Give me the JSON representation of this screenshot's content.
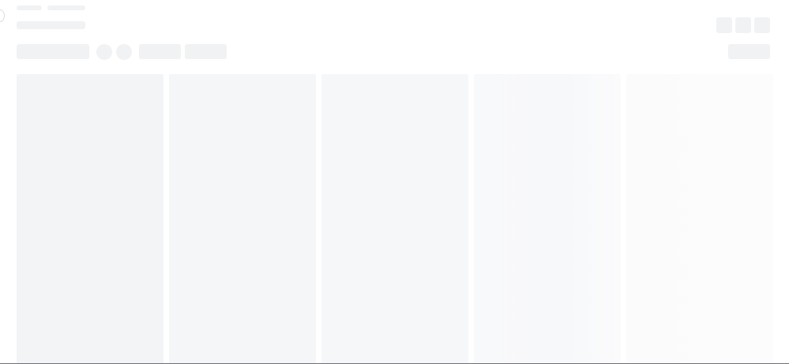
{
  "app": {
    "state": "loading-skeleton"
  },
  "header": {
    "breadcrumb": [
      "",
      ""
    ],
    "title": "",
    "icons": [
      "placeholder-icon",
      "placeholder-icon",
      "placeholder-icon"
    ]
  },
  "toolbar": {
    "search_placeholder": "",
    "avatars": [
      "",
      ""
    ],
    "filters": [
      "",
      ""
    ],
    "primary_action_label": ""
  },
  "board": {
    "columns": [
      {
        "title": ""
      },
      {
        "title": ""
      },
      {
        "title": ""
      },
      {
        "title": ""
      },
      {
        "title": ""
      }
    ]
  },
  "colors": {
    "background": "#ffffff",
    "skeleton": "#f1f2f4",
    "column": "#f3f4f6"
  }
}
